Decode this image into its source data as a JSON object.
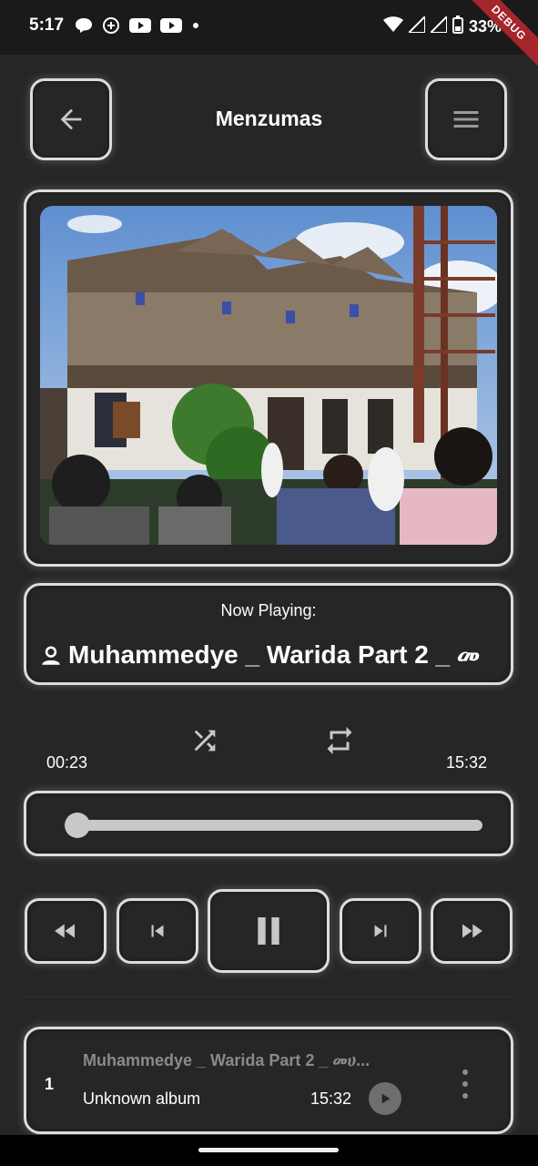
{
  "status_bar": {
    "time": "5:17",
    "battery": "33%",
    "debug_banner": "DEBUG"
  },
  "header": {
    "title": "Menzumas",
    "back_icon": "arrow-left-icon",
    "menu_icon": "hamburger-menu-icon"
  },
  "now_playing": {
    "label": "Now Playing:",
    "title": "Muhammedye _ Warida Part 2 _ መ",
    "artist_icon": "person-icon"
  },
  "controls": {
    "position": "00:23",
    "duration": "15:32",
    "progress": 0.025,
    "shuffle_icon": "shuffle-icon",
    "repeat_icon": "repeat-icon",
    "buttons": [
      "rewind-icon",
      "skip-previous-icon",
      "pause-icon",
      "skip-next-icon",
      "fast-forward-icon"
    ]
  },
  "queue": [
    {
      "index": "1",
      "title": "Muhammedye _ Warida Part 2 _ መሀ...",
      "album": "Unknown album",
      "duration": "15:32"
    }
  ],
  "colors": {
    "background": "#262626",
    "border": "#dcdcdc",
    "debug": "#a5262a"
  }
}
